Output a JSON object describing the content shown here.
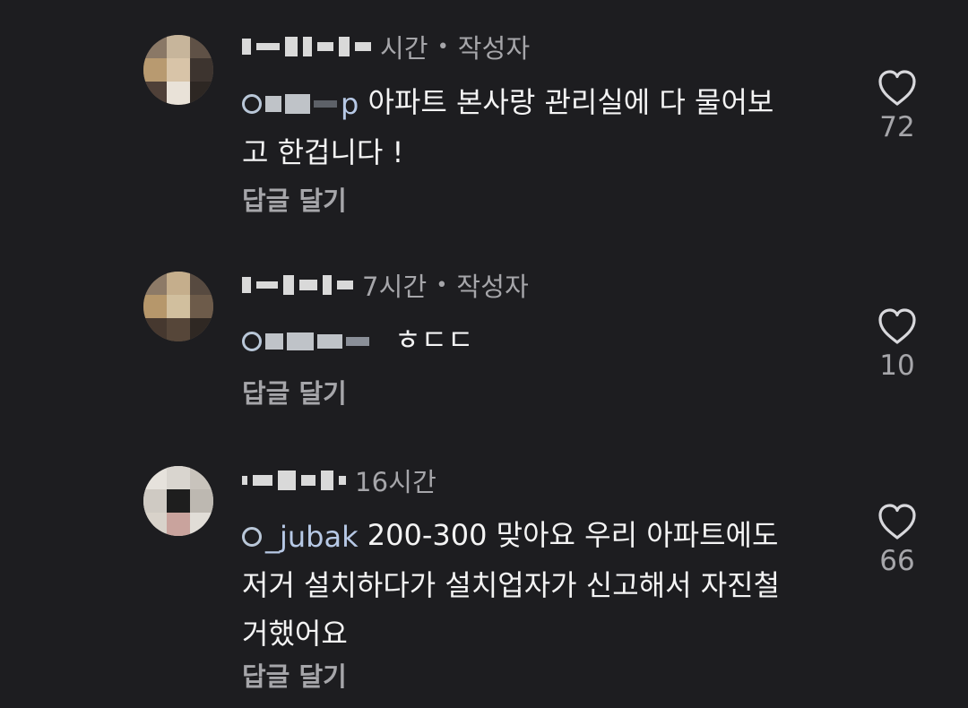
{
  "comments": [
    {
      "time": "시간",
      "author_tag": "작성자",
      "body_prefix": "p",
      "body": "아파트 본사랑 관리실에 다 물어보고 한겁니다 !",
      "reply_label": "답글 달기",
      "likes": "72",
      "like_icon": "heart-outline-icon"
    },
    {
      "time": "7시간",
      "author_tag": "작성자",
      "body_prefix": "",
      "body": "ㅎㄷㄷ",
      "reply_label": "답글 달기",
      "likes": "10",
      "like_icon": "heart-outline-icon"
    },
    {
      "time": "16시간",
      "author_tag": "",
      "body_prefix": "_jubak",
      "body": "200-300 맞아요 우리 아파트에도 저거 설치하다가 설치업자가 신고해서 자진철거했어요",
      "reply_label": "답글 달기",
      "likes": "66",
      "like_icon": "heart-outline-icon"
    }
  ],
  "colors": {
    "background": "#1d1d20",
    "primary_text": "#f4f4f4",
    "secondary_text": "#a6a6aa"
  }
}
